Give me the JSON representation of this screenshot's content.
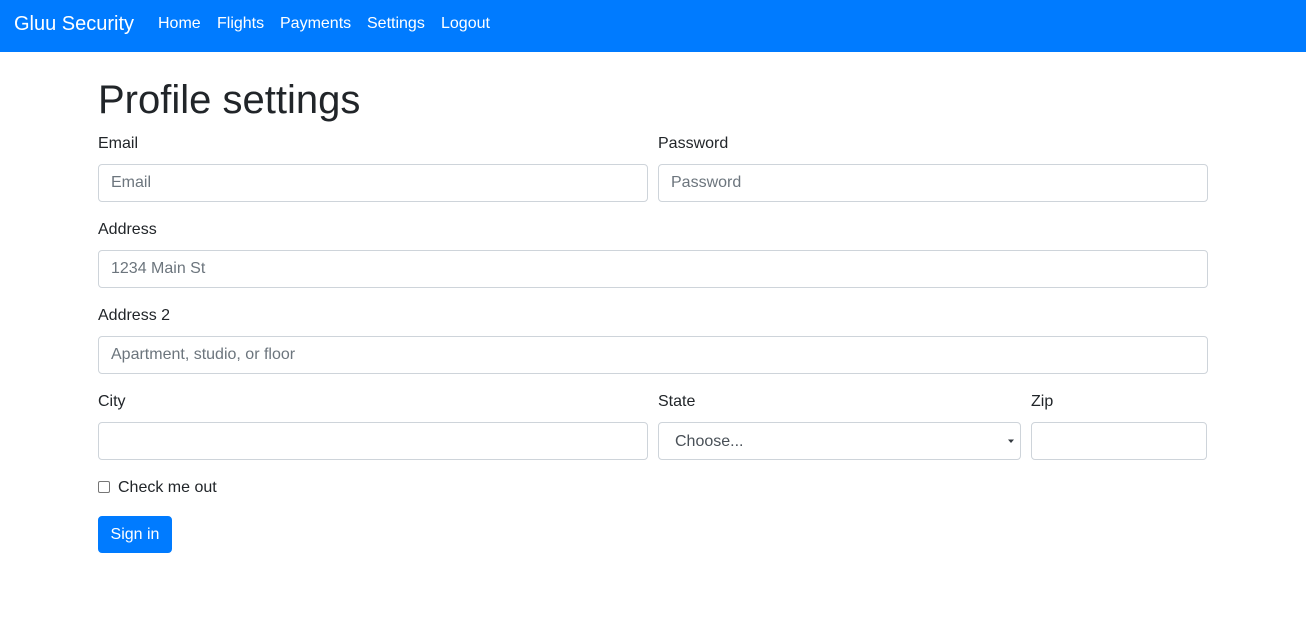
{
  "navbar": {
    "brand": "Gluu Security",
    "color": "#007bff",
    "links": [
      {
        "label": "Home"
      },
      {
        "label": "Flights"
      },
      {
        "label": "Payments"
      },
      {
        "label": "Settings"
      },
      {
        "label": "Logout"
      }
    ]
  },
  "page": {
    "title": "Profile settings"
  },
  "form": {
    "email": {
      "label": "Email",
      "placeholder": "Email",
      "value": ""
    },
    "password": {
      "label": "Password",
      "placeholder": "Password",
      "value": ""
    },
    "address": {
      "label": "Address",
      "placeholder": "1234 Main St",
      "value": ""
    },
    "address2": {
      "label": "Address 2",
      "placeholder": "Apartment, studio, or floor",
      "value": ""
    },
    "city": {
      "label": "City",
      "placeholder": "",
      "value": ""
    },
    "state": {
      "label": "State",
      "selected": "Choose...",
      "icon": "caret-down-icon"
    },
    "zip": {
      "label": "Zip",
      "placeholder": "",
      "value": ""
    },
    "checkbox": {
      "label": "Check me out",
      "checked": false
    },
    "submit": {
      "label": "Sign in",
      "color": "#007bff"
    }
  }
}
